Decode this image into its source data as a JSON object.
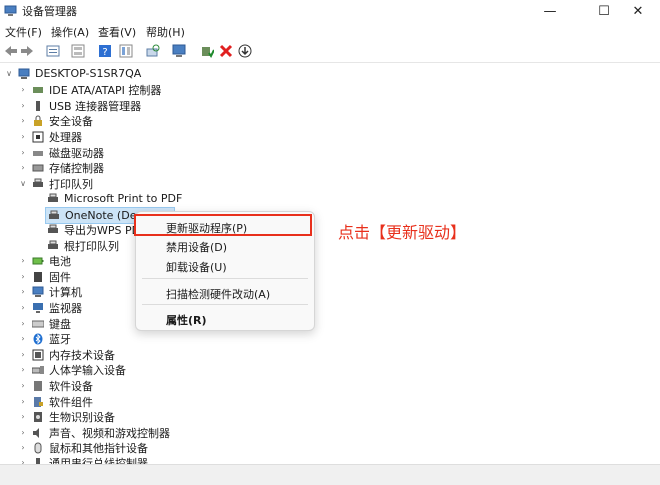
{
  "window": {
    "title": "设备管理器",
    "minimize_icon": "—",
    "maximize_icon": "☐",
    "close_icon": "✕"
  },
  "menu": [
    "文件(F)",
    "操作(A)",
    "查看(V)",
    "帮助(H)"
  ],
  "toolbar_icons": [
    "back-icon",
    "forward-icon",
    "properties-icon",
    "view-icon",
    "help-icon",
    "view-list-icon",
    "scan-icon",
    "monitor-icon",
    "enable-icon",
    "uninstall-icon",
    "update-icon"
  ],
  "tree": {
    "root": "DESKTOP-S1SR7QA",
    "items": [
      {
        "label": "IDE ATA/ATAPI 控制器",
        "expanded": false,
        "icon": "ide-icon"
      },
      {
        "label": "USB 连接器管理器",
        "expanded": false,
        "icon": "usb-icon"
      },
      {
        "label": "安全设备",
        "expanded": false,
        "icon": "security-icon"
      },
      {
        "label": "处理器",
        "expanded": false,
        "icon": "cpu-icon"
      },
      {
        "label": "磁盘驱动器",
        "expanded": false,
        "icon": "disk-icon"
      },
      {
        "label": "存储控制器",
        "expanded": false,
        "icon": "storage-icon"
      },
      {
        "label": "打印队列",
        "expanded": true,
        "icon": "printer-icon",
        "children": [
          {
            "label": "Microsoft Print to PDF",
            "icon": "printer-icon"
          },
          {
            "label": "OneNote (Desktop)",
            "icon": "printer-icon",
            "selected": true
          },
          {
            "label": "导出为WPS PDF",
            "icon": "printer-icon"
          },
          {
            "label": "根打印队列",
            "icon": "printer-icon"
          }
        ]
      },
      {
        "label": "电池",
        "expanded": false,
        "icon": "battery-icon"
      },
      {
        "label": "固件",
        "expanded": false,
        "icon": "firmware-icon"
      },
      {
        "label": "计算机",
        "expanded": false,
        "icon": "computer-icon"
      },
      {
        "label": "监视器",
        "expanded": false,
        "icon": "monitor-icon"
      },
      {
        "label": "键盘",
        "expanded": false,
        "icon": "keyboard-icon"
      },
      {
        "label": "蓝牙",
        "expanded": false,
        "icon": "bluetooth-icon"
      },
      {
        "label": "内存技术设备",
        "expanded": false,
        "icon": "memory-icon"
      },
      {
        "label": "人体学输入设备",
        "expanded": false,
        "icon": "hid-icon"
      },
      {
        "label": "软件设备",
        "expanded": false,
        "icon": "software-icon"
      },
      {
        "label": "软件组件",
        "expanded": false,
        "icon": "component-icon"
      },
      {
        "label": "生物识别设备",
        "expanded": false,
        "icon": "biometric-icon"
      },
      {
        "label": "声音、视频和游戏控制器",
        "expanded": false,
        "icon": "sound-icon"
      },
      {
        "label": "鼠标和其他指针设备",
        "expanded": false,
        "icon": "mouse-icon"
      },
      {
        "label": "通用串行总线控制器",
        "expanded": false,
        "icon": "usb-controller-icon"
      }
    ]
  },
  "context_menu": {
    "update_driver": "更新驱动程序(P)",
    "disable_device": "禁用设备(D)",
    "uninstall_device": "卸载设备(U)",
    "scan_hardware": "扫描检测硬件改动(A)",
    "properties": "属性(R)"
  },
  "annotation": "点击【更新驱动】",
  "colors": {
    "accent": "#e8301c",
    "selection": "#cce4f7"
  }
}
